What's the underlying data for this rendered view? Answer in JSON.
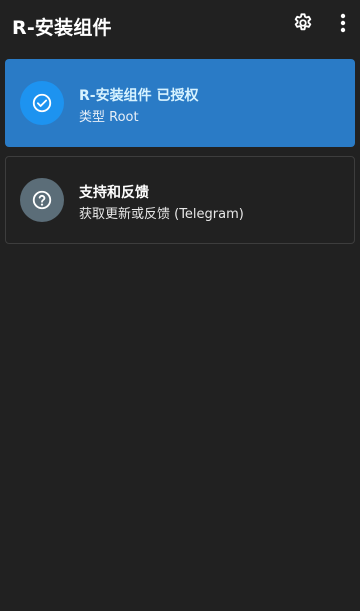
{
  "app": {
    "title": "R-安装组件",
    "colors": {
      "background": "#212121",
      "accent": "#2a7bc6",
      "accent_icon": "#1d93f0",
      "secondary_icon": "#5b6d78"
    }
  },
  "toolbar": {
    "settings_icon": "gear-icon",
    "more_icon": "more-vert-icon"
  },
  "cards": {
    "status": {
      "icon": "check-circle-icon",
      "title": "R-安装组件 已授权",
      "subtitle": "类型 Root"
    },
    "support": {
      "icon": "help-circle-icon",
      "title": "支持和反馈",
      "subtitle": "获取更新或反馈 (Telegram)"
    }
  }
}
